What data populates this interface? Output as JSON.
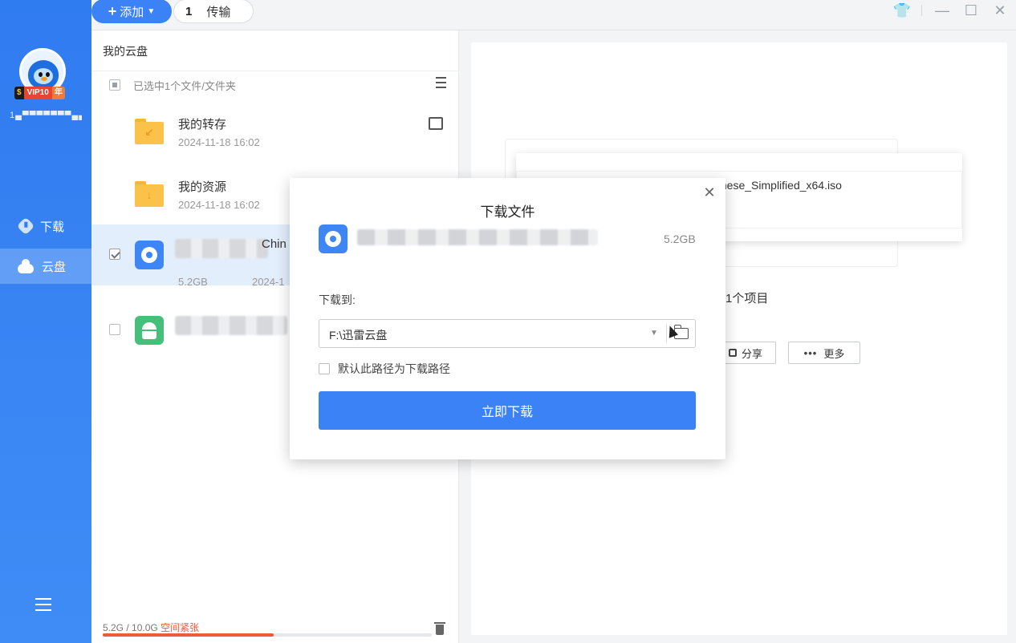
{
  "sidebar": {
    "vip_badge": {
      "s": "$",
      "vip": "VIP10",
      "year": "年"
    },
    "username": "1▄▀▀▀▀▀▀▀▄▄",
    "nav": [
      {
        "label": "下载",
        "icon": "download-icon"
      },
      {
        "label": "云盘",
        "icon": "cloud-icon"
      }
    ]
  },
  "topbar": {
    "add_label": "添加",
    "transfer_count": "1",
    "transfer_label": "传输"
  },
  "file_panel": {
    "title": "我的云盘",
    "selection_text": "已选中1个文件/文件夹",
    "files": [
      {
        "name": "我的转存",
        "date": "2024-11-18 16:02",
        "type": "folder"
      },
      {
        "name": "我的资源",
        "date": "2024-11-18 16:02",
        "type": "folder"
      },
      {
        "name_tail": "Chin",
        "size": "5.2GB",
        "date": "2024-1",
        "type": "iso",
        "checked": true
      },
      {
        "type": "apk",
        "checked": false
      }
    ],
    "storage": {
      "used": "5.2G / 10.0G",
      "warning": "空间紧张",
      "fill_fraction": 0.52
    }
  },
  "detail_panel": {
    "preview_name": "hinese_Simplified_x64.iso",
    "selection_text": "择1个项目",
    "share_label": "分享",
    "more_label": "更多"
  },
  "modal": {
    "title": "下载文件",
    "size": "5.2GB",
    "path_label": "下载到:",
    "path_value": "F:\\迅雷云盘",
    "default_label": "默认此路径为下载路径",
    "download_label": "立即下载"
  },
  "colors": {
    "accent": "#3c82f7",
    "sidebar": "#2f7bf0",
    "warning": "#ef5a3c",
    "folder": "#fbc24a"
  }
}
